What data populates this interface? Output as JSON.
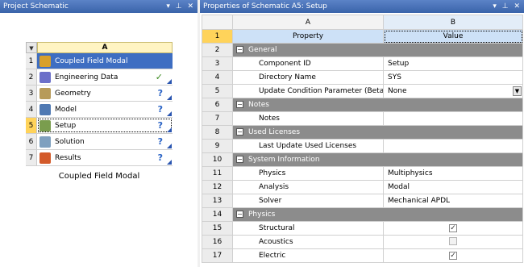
{
  "left_panel": {
    "title": "Project Schematic",
    "controls": "▾ ⊥ ✕",
    "system": {
      "column_header": "A",
      "collapse_glyph": "▼",
      "caption": "Coupled Field Modal",
      "rows": [
        {
          "num": "1",
          "label": "Coupled Field Modal",
          "status": "",
          "icon_color": "#d8a02a"
        },
        {
          "num": "2",
          "label": "Engineering Data",
          "status": "✓",
          "icon_color": "#6b6fc9"
        },
        {
          "num": "3",
          "label": "Geometry",
          "status": "?",
          "icon_color": "#b79b5a"
        },
        {
          "num": "4",
          "label": "Model",
          "status": "?",
          "icon_color": "#4f79b3"
        },
        {
          "num": "5",
          "label": "Setup",
          "status": "?",
          "icon_color": "#7a9d4e"
        },
        {
          "num": "6",
          "label": "Solution",
          "status": "?",
          "icon_color": "#7fa0bf"
        },
        {
          "num": "7",
          "label": "Results",
          "status": "?",
          "icon_color": "#d35a2a"
        }
      ]
    }
  },
  "right_panel": {
    "title": "Properties of Schematic A5: Setup",
    "controls": "▾ ⊥ ✕",
    "col_a": "A",
    "col_b": "B",
    "header_row": {
      "num": "1",
      "property": "Property",
      "value": "Value"
    },
    "rows": [
      {
        "num": "2",
        "section": "General"
      },
      {
        "num": "3",
        "property": "Component ID",
        "value": "Setup"
      },
      {
        "num": "4",
        "property": "Directory Name",
        "value": "SYS"
      },
      {
        "num": "5",
        "property": "Update Condition Parameter (Beta)",
        "value": "None",
        "dropdown": true
      },
      {
        "num": "6",
        "section": "Notes"
      },
      {
        "num": "7",
        "property": "Notes",
        "value": ""
      },
      {
        "num": "8",
        "section": "Used Licenses"
      },
      {
        "num": "9",
        "property": "Last Update Used Licenses",
        "value": ""
      },
      {
        "num": "10",
        "section": "System Information"
      },
      {
        "num": "11",
        "property": "Physics",
        "value": "Multiphysics"
      },
      {
        "num": "12",
        "property": "Analysis",
        "value": "Modal"
      },
      {
        "num": "13",
        "property": "Solver",
        "value": "Mechanical APDL"
      },
      {
        "num": "14",
        "section": "Physics"
      },
      {
        "num": "15",
        "property": "Structural",
        "checkbox": true,
        "checked": true
      },
      {
        "num": "16",
        "property": "Acoustics",
        "checkbox": true,
        "checked": false
      },
      {
        "num": "17",
        "property": "Electric",
        "checkbox": true,
        "checked": true
      }
    ]
  }
}
